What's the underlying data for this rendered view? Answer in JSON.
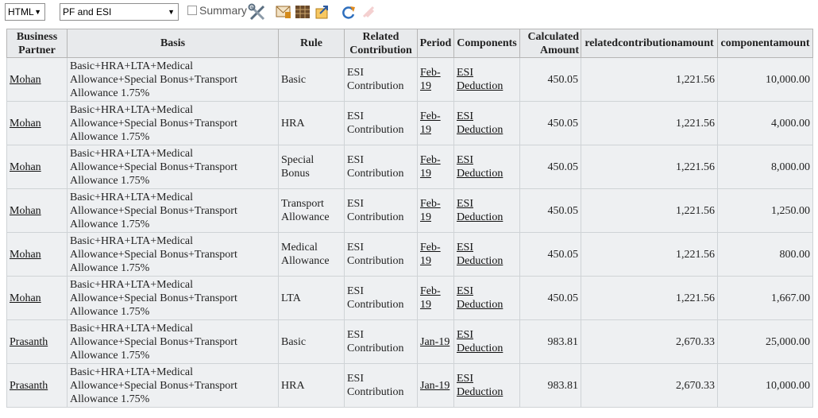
{
  "toolbar": {
    "format_select": "HTML",
    "report_select": "PF and ESI",
    "summary_label": "Summary",
    "icons": [
      "settings-icon",
      "email-icon",
      "excel-icon",
      "export-icon",
      "refresh-icon",
      "clear-icon"
    ]
  },
  "columns": [
    "Business Partner",
    "Basis",
    "Rule",
    "Related Contribution",
    "Period",
    "Components",
    "Calculated Amount",
    "relatedcontributionamount",
    "componentamount"
  ],
  "rows": [
    {
      "partner": "Mohan",
      "basis": "Basic+HRA+LTA+Medical Allowance+Special Bonus+Transport Allowance 1.75%",
      "rule": "Basic",
      "related": "ESI Contribution",
      "period": "Feb-19",
      "component": "ESI Deduction",
      "calculated": "450.05",
      "related_amount": "1,221.56",
      "component_amount": "10,000.00"
    },
    {
      "partner": "Mohan",
      "basis": "Basic+HRA+LTA+Medical Allowance+Special Bonus+Transport Allowance 1.75%",
      "rule": "HRA",
      "related": "ESI Contribution",
      "period": "Feb-19",
      "component": "ESI Deduction",
      "calculated": "450.05",
      "related_amount": "1,221.56",
      "component_amount": "4,000.00"
    },
    {
      "partner": "Mohan",
      "basis": "Basic+HRA+LTA+Medical Allowance+Special Bonus+Transport Allowance 1.75%",
      "rule": "Special Bonus",
      "related": "ESI Contribution",
      "period": "Feb-19",
      "component": "ESI Deduction",
      "calculated": "450.05",
      "related_amount": "1,221.56",
      "component_amount": "8,000.00"
    },
    {
      "partner": "Mohan",
      "basis": "Basic+HRA+LTA+Medical Allowance+Special Bonus+Transport Allowance 1.75%",
      "rule": "Transport Allowance",
      "related": "ESI Contribution",
      "period": "Feb-19",
      "component": "ESI Deduction",
      "calculated": "450.05",
      "related_amount": "1,221.56",
      "component_amount": "1,250.00"
    },
    {
      "partner": "Mohan",
      "basis": "Basic+HRA+LTA+Medical Allowance+Special Bonus+Transport Allowance 1.75%",
      "rule": "Medical Allowance",
      "related": "ESI Contribution",
      "period": "Feb-19",
      "component": "ESI Deduction",
      "calculated": "450.05",
      "related_amount": "1,221.56",
      "component_amount": "800.00"
    },
    {
      "partner": "Mohan",
      "basis": "Basic+HRA+LTA+Medical Allowance+Special Bonus+Transport Allowance 1.75%",
      "rule": "LTA",
      "related": "ESI Contribution",
      "period": "Feb-19",
      "component": "ESI Deduction",
      "calculated": "450.05",
      "related_amount": "1,221.56",
      "component_amount": "1,667.00"
    },
    {
      "partner": "Prasanth",
      "basis": "Basic+HRA+LTA+Medical Allowance+Special Bonus+Transport Allowance 1.75%",
      "rule": "Basic",
      "related": "ESI Contribution",
      "period": "Jan-19",
      "component": "ESI Deduction",
      "calculated": "983.81",
      "related_amount": "2,670.33",
      "component_amount": "25,000.00"
    },
    {
      "partner": "Prasanth",
      "basis": "Basic+HRA+LTA+Medical Allowance+Special Bonus+Transport Allowance 1.75%",
      "rule": "HRA",
      "related": "ESI Contribution",
      "period": "Jan-19",
      "component": "ESI Deduction",
      "calculated": "983.81",
      "related_amount": "2,670.33",
      "component_amount": "10,000.00"
    }
  ]
}
